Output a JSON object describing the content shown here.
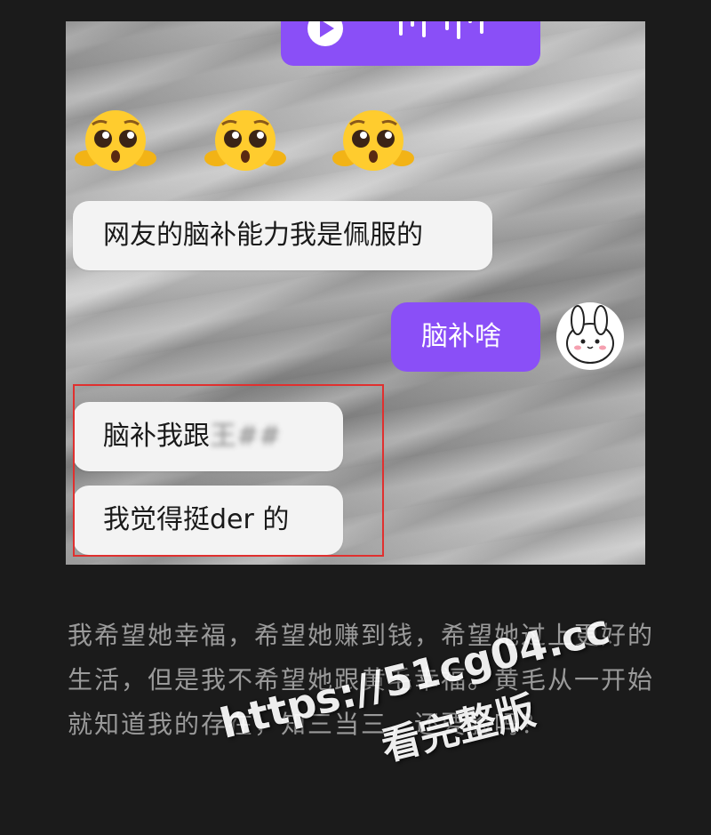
{
  "chat": {
    "messages": [
      {
        "side": "left",
        "text": "网友的脑补能力我是佩服的"
      },
      {
        "side": "right",
        "text": "脑补啥"
      },
      {
        "side": "left",
        "text": "脑补我跟",
        "blurred_suffix": "王##"
      },
      {
        "side": "left",
        "text": "我觉得挺der 的"
      }
    ],
    "emoji_row": [
      "pleading-face-emoji",
      "pleading-face-emoji",
      "pleading-face-emoji"
    ],
    "voice_message": {
      "icon": "play-icon"
    },
    "avatar": {
      "icon": "rabbit-avatar-icon"
    },
    "highlight_color": "#e0302f",
    "accent_color": "#8a4ff7"
  },
  "article": {
    "text": "我希望她幸福，希望她赚到钱，希望她过上更好的生活，但是我不希望她跟黄毛幸福。黄毛从一开始就知道我的存在，知三当三，还要脸吗？"
  },
  "watermark": {
    "url": "https://51cg04.cc",
    "caption": "看完整版"
  }
}
